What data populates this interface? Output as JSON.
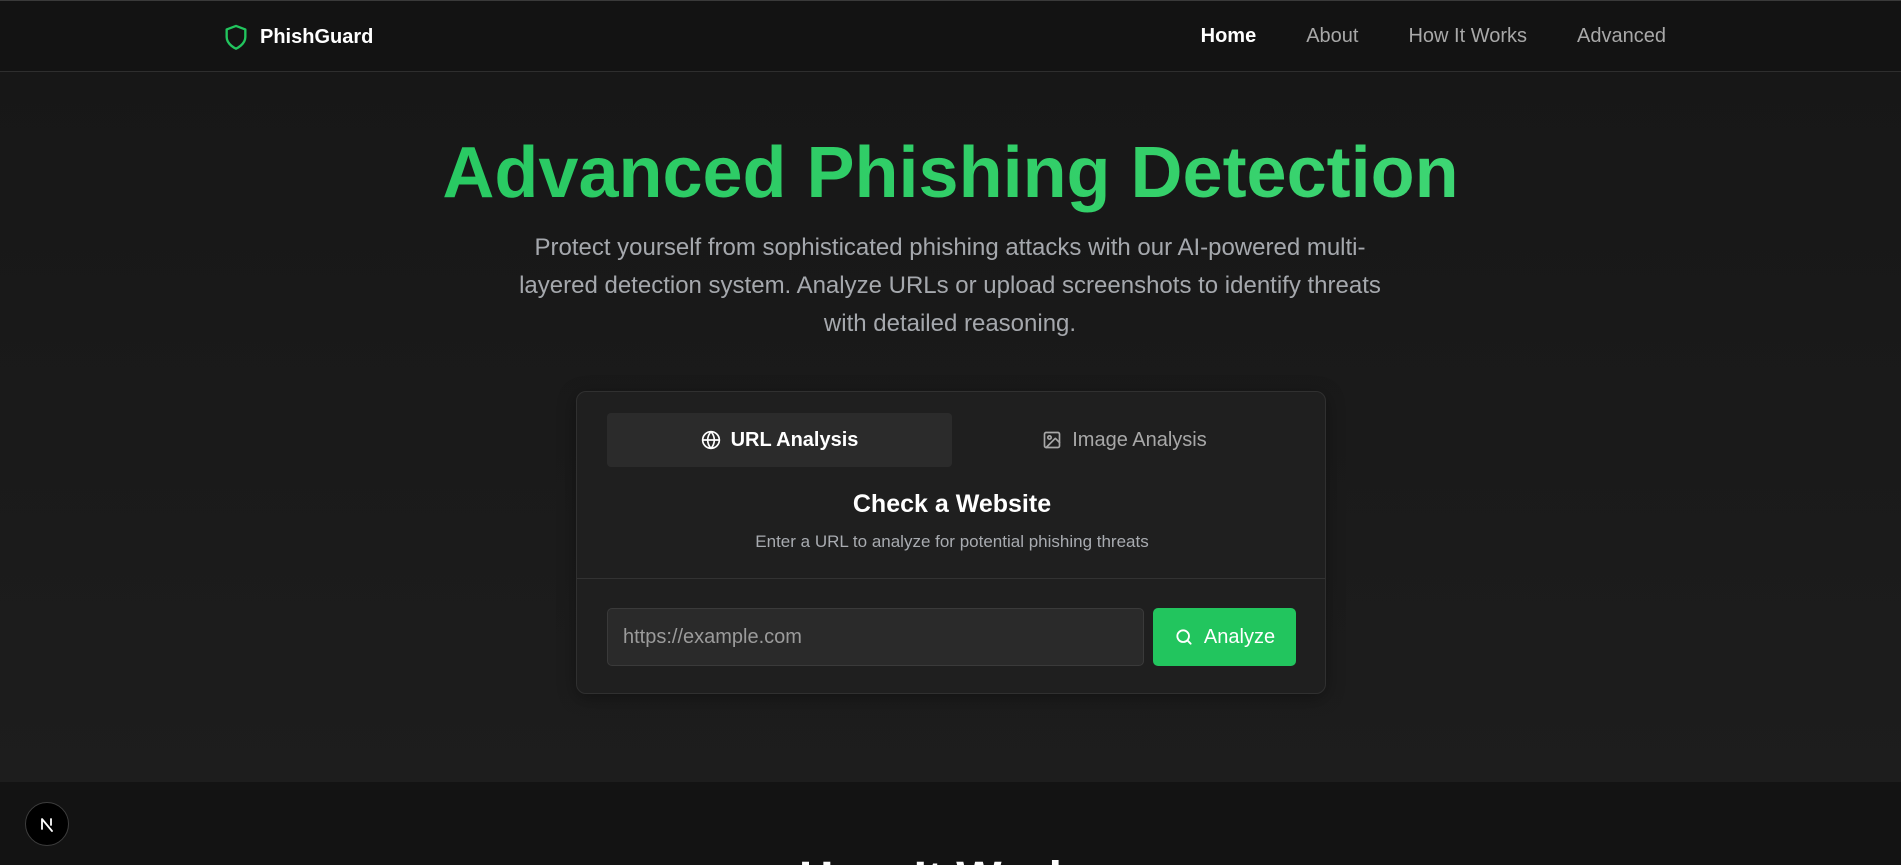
{
  "nav": {
    "brand_name": "PhishGuard",
    "links": [
      {
        "label": "Home",
        "active": true
      },
      {
        "label": "About"
      },
      {
        "label": "How It Works"
      },
      {
        "label": "Advanced"
      }
    ]
  },
  "hero": {
    "title": "Advanced Phishing Detection",
    "subtitle": "Protect yourself from sophisticated phishing attacks with our AI-powered multi-layered detection system. Analyze URLs or upload screenshots to identify threats with detailed reasoning."
  },
  "card": {
    "tabs": [
      {
        "label": "URL Analysis",
        "icon": "globe-icon",
        "active": true
      },
      {
        "label": "Image Analysis",
        "icon": "image-icon",
        "active": false
      }
    ],
    "title": "Check a Website",
    "description": "Enter a URL to analyze for potential phishing threats",
    "input_placeholder": "https://example.com",
    "input_value": "",
    "analyze_label": "Analyze"
  },
  "next_section": {
    "title": "How It Works"
  },
  "colors": {
    "accent": "#22c55e",
    "background": "#1b1b1b",
    "nav_background": "#131313"
  }
}
